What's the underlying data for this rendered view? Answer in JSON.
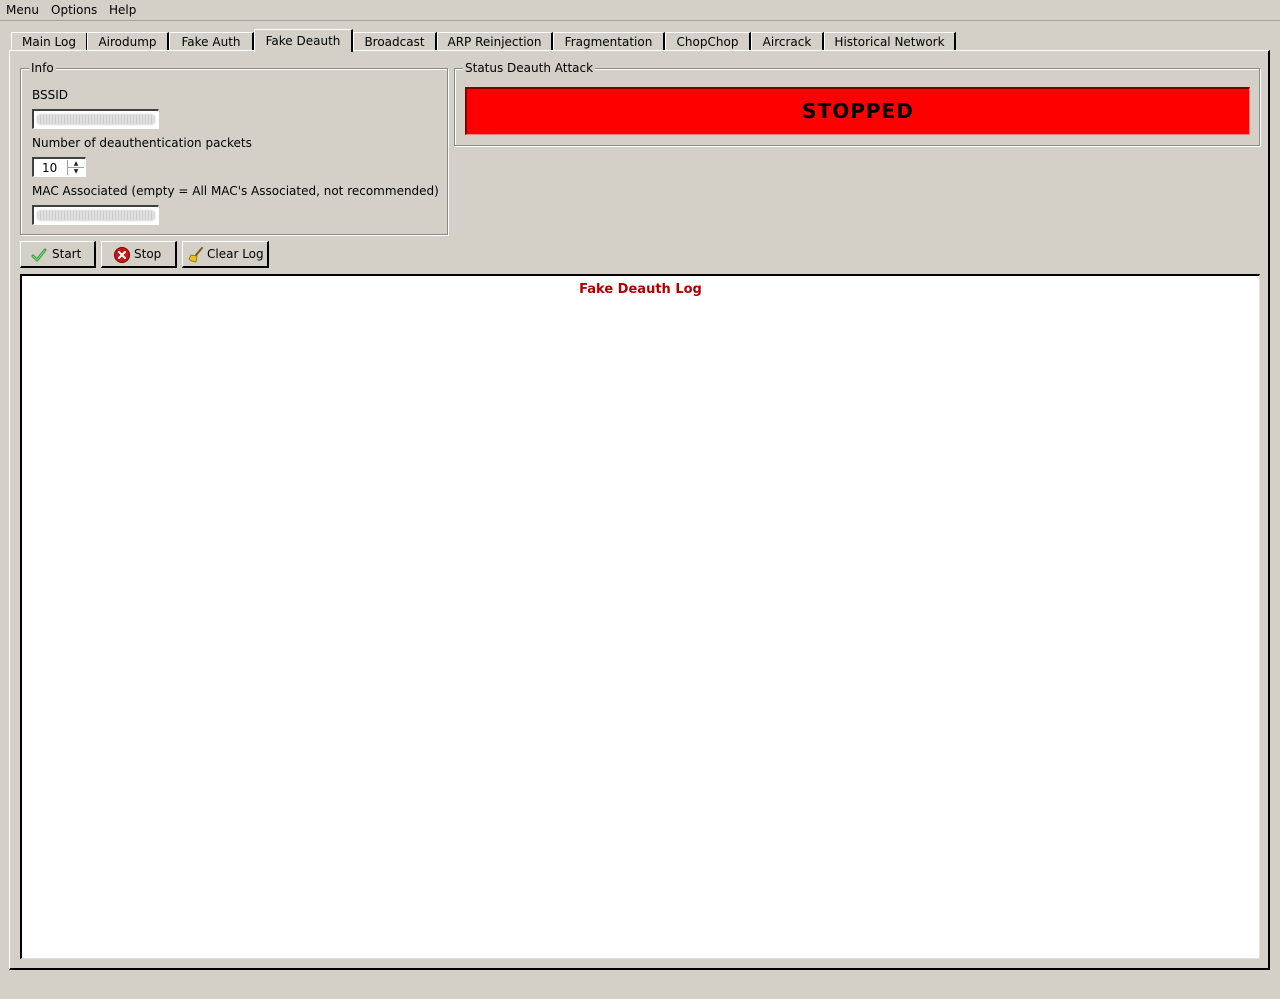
{
  "menu": [
    "Menu",
    "Options",
    "Help"
  ],
  "tabs": [
    {
      "label": "Main Log"
    },
    {
      "label": "Airodump"
    },
    {
      "label": "Fake Auth"
    },
    {
      "label": "Fake Deauth",
      "active": true
    },
    {
      "label": "Broadcast"
    },
    {
      "label": "ARP Reinjection"
    },
    {
      "label": "Fragmentation"
    },
    {
      "label": "ChopChop"
    },
    {
      "label": "Aircrack"
    },
    {
      "label": "Historical Network"
    }
  ],
  "info": {
    "title": "Info",
    "bssid_label": "BSSID",
    "bssid_value": "",
    "deauth_label": "Number of deauthentication packets",
    "deauth_count": "10",
    "mac_label": "MAC Associated (empty = All MAC's Associated, not recommended)",
    "mac_value": ""
  },
  "status": {
    "title": "Status Deauth Attack",
    "state": "STOPPED",
    "color": "#ff0000"
  },
  "buttons": {
    "start": "Start",
    "stop": "Stop",
    "clear_log": "Clear Log"
  },
  "log": {
    "title": "Fake Deauth Log",
    "title_color": "#b00000",
    "lines": []
  }
}
